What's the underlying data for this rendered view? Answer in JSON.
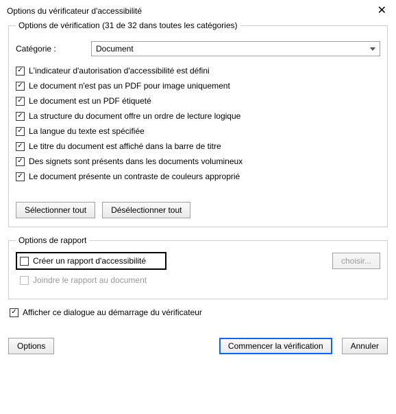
{
  "title": "Options du vérificateur d'accessibilité",
  "verificationGroup": {
    "legend": "Options de vérification (31 de 32 dans toutes les catégories)",
    "categoryLabel": "Catégorie :",
    "categorySelected": "Document",
    "checks": [
      "L'indicateur d'autorisation d'accessibilité est défini",
      "Le document n'est pas un PDF pour image uniquement",
      "Le document est un PDF étiqueté",
      "La structure du document offre un ordre de lecture logique",
      "La langue du texte est spécifiée",
      "Le titre du document est affiché dans la barre de titre",
      "Des signets sont présents dans les documents volumineux",
      "Le document présente un contraste de couleurs approprié"
    ],
    "selectAll": "Sélectionner tout",
    "deselectAll": "Désélectionner tout"
  },
  "reportGroup": {
    "legend": "Options de rapport",
    "createReport": "Créer un rapport d'accessibilité",
    "attachReport": "Joindre le rapport au document",
    "choose": "choisir..."
  },
  "showAtStartup": "Afficher ce dialogue au démarrage du vérificateur",
  "footer": {
    "options": "Options",
    "start": "Commencer la vérification",
    "cancel": "Annuler"
  }
}
